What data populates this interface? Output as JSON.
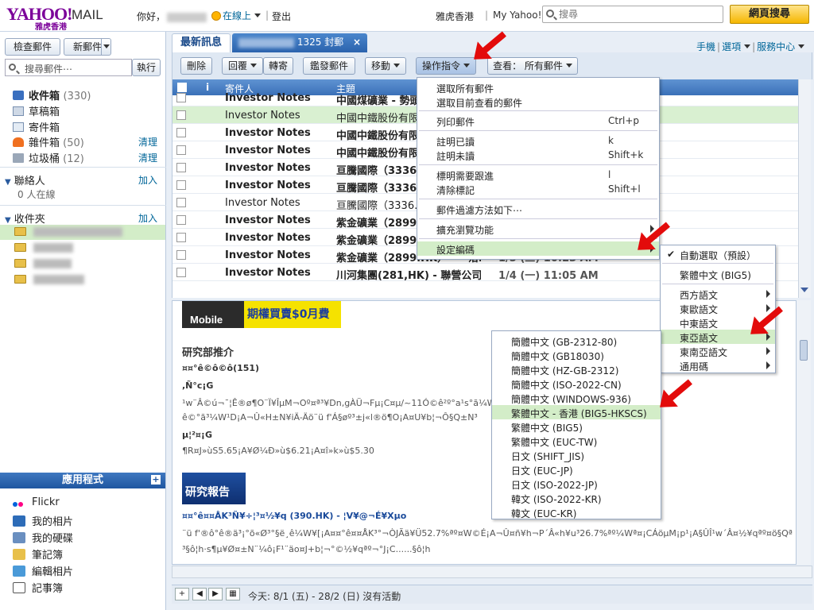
{
  "header": {
    "logo": "YAHOO!",
    "logo_mail": "MAIL",
    "logo_sub": "雅虎香港",
    "greeting": "你好，",
    "status": "在線上",
    "logout": "登出",
    "hk_link": "雅虎香港",
    "my_yahoo": "My Yahoo!",
    "search_placeholder": "搜尋",
    "web_search_button": "網頁搜尋"
  },
  "sidebar": {
    "check_mail": "檢查郵件",
    "new_mail": "新郵件",
    "search_mail_placeholder": "搜尋郵件⋯",
    "run": "執行",
    "folders": [
      {
        "label": "收件箱",
        "count": "(330)",
        "action": ""
      },
      {
        "label": "草稿箱",
        "count": "",
        "action": ""
      },
      {
        "label": "寄件箱",
        "count": "",
        "action": ""
      },
      {
        "label": "雜件箱",
        "count": "(50)",
        "action": "清理"
      },
      {
        "label": "垃圾桶",
        "count": "(12)",
        "action": "清理"
      }
    ],
    "contacts": {
      "label": "聯絡人",
      "action": "加入",
      "online": "0 人在線"
    },
    "inbox_folders": {
      "label": "收件夾",
      "action": "加入"
    },
    "apps_header": "應用程式",
    "apps": [
      "Flickr",
      "我的相片",
      "我的硬碟",
      "筆記簿",
      "編輯相片",
      "記事簿"
    ]
  },
  "tabs": {
    "latest": "最新訊息",
    "folder_count": "1325 封郵"
  },
  "top_links": {
    "mobile": "手機",
    "options": "選項",
    "service": "服務中心"
  },
  "toolbar": {
    "delete": "刪除",
    "reply": "回覆",
    "forward": "轉寄",
    "spam": "鑑發郵件",
    "move": "移動",
    "actions": "操作指令",
    "view": "查看： 所有郵件"
  },
  "list": {
    "col_sender": "寄件人",
    "col_subject": "主題",
    "rows": [
      {
        "sender": "Investor Notes",
        "subject": "中國煤礦業 - 勢頭",
        "date": ""
      },
      {
        "sender": "Investor Notes",
        "subject": "中國中鐵股份有限",
        "date": ""
      },
      {
        "sender": "Investor Notes",
        "subject": "中國中鐵股份有限",
        "date": ""
      },
      {
        "sender": "Investor Notes",
        "subject": "中國中鐵股份有限",
        "date": ""
      },
      {
        "sender": "Investor Notes",
        "subject": "亘騰國際（3336.",
        "date": ""
      },
      {
        "sender": "Investor Notes",
        "subject": "亘騰國際（3336.",
        "date": ""
      },
      {
        "sender": "Investor Notes",
        "subject": "亘騰國際（3336.H",
        "date": ""
      },
      {
        "sender": "Investor Notes",
        "subject": "紫金礦業（2899.",
        "date": ""
      },
      {
        "sender": "Investor Notes",
        "subject": "紫金礦業（2899.",
        "date": ""
      },
      {
        "sender": "Investor Notes",
        "subject": "紫金礦業（2899.HK）——落…",
        "date": "1/5 (二) 10:23 AM"
      },
      {
        "sender": "Investor Notes",
        "subject": "川河集團(281,HK) - 聯營公司…",
        "date": "1/4 (一) 11:05 AM"
      }
    ]
  },
  "actions_menu": [
    {
      "label": "選取所有郵件",
      "key": ""
    },
    {
      "label": "選取目前查看的郵件",
      "key": ""
    },
    {
      "label": "列印郵件",
      "key": "Ctrl+p"
    },
    {
      "label": "註明已讀",
      "key": "k"
    },
    {
      "label": "註明未讀",
      "key": "Shift+k"
    },
    {
      "label": "標明需要跟進",
      "key": "l"
    },
    {
      "label": "清除標記",
      "key": "Shift+l"
    },
    {
      "label": "郵件過濾方法如下⋯",
      "key": ""
    },
    {
      "label": "擴充瀏覽功能",
      "key": ""
    },
    {
      "label": "設定編碼",
      "key": ""
    }
  ],
  "encoding_menu": {
    "auto": "自動選取（預設）",
    "big5": "繁體中文 (BIG5)",
    "groups": [
      "西方語文",
      "東歐語文",
      "中東語文",
      "東亞語文",
      "東南亞語文",
      "通用碼"
    ]
  },
  "east_asian_menu": [
    "簡體中文 (GB-2312-80)",
    "簡體中文 (GB18030)",
    "簡體中文 (HZ-GB-2312)",
    "簡體中文 (ISO-2022-CN)",
    "簡體中文 (WINDOWS-936)",
    "繁體中文 - 香港 (BIG5-HKSCS)",
    "繁體中文 (BIG5)",
    "繁體中文 (EUC-TW)",
    "日文 (SHIFT_JIS)",
    "日文 (EUC-JP)",
    "日文 (ISO-2022-JP)",
    "韓文 (ISO-2022-KR)",
    "韓文 (EUC-KR)"
  ],
  "preview": {
    "banner_mobile": "Mobile",
    "banner_text": "期權買賣$0月費",
    "heading": "研究部推介",
    "lines": [
      "¤¤°ê©ô©ô(151)",
      ",Ñ°c¡G",
      "¹w¨Â©ú¬¯¦Ê®ø¶O¨Ï¥ÎµM¬Oº¤ª³¥Dn,gÀÜ¬Fµ¡C¤µ/~11Ó©ê²º°a¹s°ã¼Wª",
      "ê©°ã³¼W¹D¡A¬Û«H±N¥iÄ-Äö¨ü f'Á§øº³±j«l®ö¶O¡A¤U¥b¦¬Ô§Q±N³",
      "µ¦²¤¡G",
      "¶R¤J»ùS5.65¡A¥Ø¼Ð»ù$6.21¡A¤î»k»ù$5.30"
    ],
    "banner2": "研究報告",
    "link_line": "¤¤°ê¤¤ÅK³Ñ¥÷¦³¤½¥q (390.HK) - ¦V¥@¬É¥Xµo",
    "body_lines": [
      "¨ü f'®ô°ê®ä³¡°õ«Ø³°§ë¸ê¼W¥[¡A¤¤°ê¤¤ÅK³°¬ÒJÃä¥Ü52.7%ªº¤W©É¡A¬Û¤ñ¥h¬P´Â«h¥u³26.7%ªº¼Wª¤¡CÁöµM¡p¹¡A§ÛÎ¹w´Â¤½¥qªº¤ö§Qª",
      "³§ô¦h·s¶µ¥Ø¤±N¨¼ô¡F¹¨äo¤J+b¦¬°©½¥qªº¬°J¡C......§ô¦h"
    ]
  },
  "statusbar": {
    "text": "今天: 8/1 (五) - 28/2 (日)  沒有活動"
  }
}
